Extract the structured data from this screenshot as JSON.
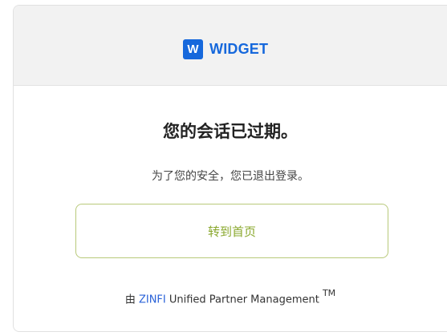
{
  "colors": {
    "brand_blue": "#1668dc",
    "button_green": "#8aa82e",
    "button_border": "#b8c97a",
    "link_blue": "#2a62d8"
  },
  "header": {
    "logo_mark": "W",
    "logo_text": "WIDGET"
  },
  "message": {
    "title": "您的会话已过期。",
    "subtitle": "为了您的安全，您已退出登录。"
  },
  "action": {
    "home_label": "转到首页"
  },
  "footer": {
    "prefix": "由 ",
    "brand": "ZINFI",
    "suffix": " Unified Partner Management ",
    "trademark": "TM"
  }
}
